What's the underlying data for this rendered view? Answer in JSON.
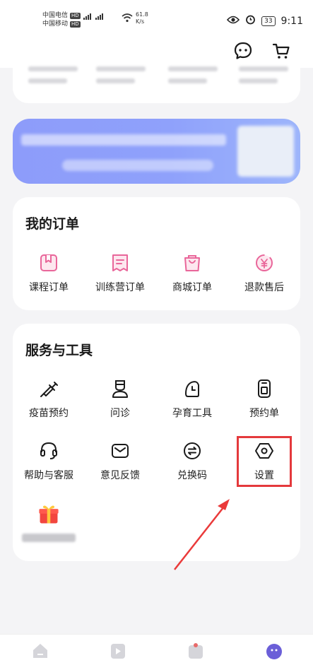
{
  "status_bar": {
    "carrier_1": "中国电信",
    "carrier_2": "中国移动",
    "hd_badge": "HD",
    "net_speed_value": "61.8",
    "net_speed_unit": "K/s",
    "battery": "33",
    "time": "9:11"
  },
  "header": {
    "icons": [
      "message-icon",
      "cart-icon"
    ]
  },
  "orders": {
    "title": "我的订单",
    "items": [
      {
        "label": "课程订单",
        "icon": "course-order-icon"
      },
      {
        "label": "训练营订单",
        "icon": "camp-order-icon"
      },
      {
        "label": "商城订单",
        "icon": "mall-order-icon"
      },
      {
        "label": "退款售后",
        "icon": "refund-icon"
      }
    ]
  },
  "services": {
    "title": "服务与工具",
    "items": [
      {
        "label": "疫苗预约",
        "icon": "vaccine-icon"
      },
      {
        "label": "问诊",
        "icon": "doctor-icon"
      },
      {
        "label": "孕育工具",
        "icon": "pregnancy-tool-icon"
      },
      {
        "label": "预约单",
        "icon": "appointment-icon"
      },
      {
        "label": "帮助与客服",
        "icon": "headset-icon"
      },
      {
        "label": "意见反馈",
        "icon": "feedback-icon"
      },
      {
        "label": "兑换码",
        "icon": "exchange-icon"
      },
      {
        "label": "设置",
        "icon": "settings-icon"
      }
    ]
  },
  "colors": {
    "accent_purple": "#8d9cfa",
    "order_icon_pink": "#e9669a",
    "highlight_red": "#e4393c"
  },
  "bottom_nav": {
    "items": [
      "home-icon",
      "video-icon",
      "mall-icon",
      "profile-icon"
    ]
  }
}
